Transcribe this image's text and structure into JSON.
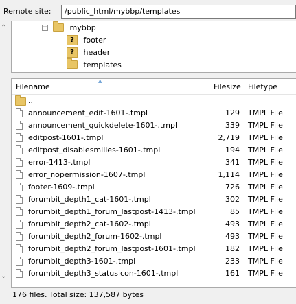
{
  "remote_site": {
    "label": "Remote site:",
    "path": "/public_html/mybbp/templates"
  },
  "tree": {
    "root": {
      "label": "mybbp",
      "expander": "−",
      "icon": "folder-icon"
    },
    "children": [
      {
        "label": "footer",
        "icon": "unknown-folder-icon",
        "glyph": "?"
      },
      {
        "label": "header",
        "icon": "unknown-folder-icon",
        "glyph": "?"
      },
      {
        "label": "templates",
        "icon": "folder-icon"
      }
    ]
  },
  "file_list": {
    "columns": {
      "name": "Filename",
      "size": "Filesize",
      "type": "Filetype"
    },
    "parent_dir": "..",
    "rows": [
      {
        "name": "announcement_edit-1601-.tmpl",
        "size": "129",
        "type": "TMPL File"
      },
      {
        "name": "announcement_quickdelete-1601-.tmpl",
        "size": "339",
        "type": "TMPL File"
      },
      {
        "name": "editpost-1601-.tmpl",
        "size": "2,719",
        "type": "TMPL File"
      },
      {
        "name": "editpost_disablesmilies-1601-.tmpl",
        "size": "194",
        "type": "TMPL File"
      },
      {
        "name": "error-1413-.tmpl",
        "size": "341",
        "type": "TMPL File"
      },
      {
        "name": "error_nopermission-1607-.tmpl",
        "size": "1,114",
        "type": "TMPL File"
      },
      {
        "name": "footer-1609-.tmpl",
        "size": "726",
        "type": "TMPL File"
      },
      {
        "name": "forumbit_depth1_cat-1601-.tmpl",
        "size": "302",
        "type": "TMPL File"
      },
      {
        "name": "forumbit_depth1_forum_lastpost-1413-.tmpl",
        "size": "85",
        "type": "TMPL File"
      },
      {
        "name": "forumbit_depth2_cat-1602-.tmpl",
        "size": "493",
        "type": "TMPL File"
      },
      {
        "name": "forumbit_depth2_forum-1602-.tmpl",
        "size": "493",
        "type": "TMPL File"
      },
      {
        "name": "forumbit_depth2_forum_lastpost-1601-.tmpl",
        "size": "182",
        "type": "TMPL File"
      },
      {
        "name": "forumbit_depth3-1601-.tmpl",
        "size": "233",
        "type": "TMPL File"
      },
      {
        "name": "forumbit_depth3_statusicon-1601-.tmpl",
        "size": "161",
        "type": "TMPL File"
      }
    ]
  },
  "status_bar": {
    "text": "176 files. Total size: 137,587 bytes"
  }
}
